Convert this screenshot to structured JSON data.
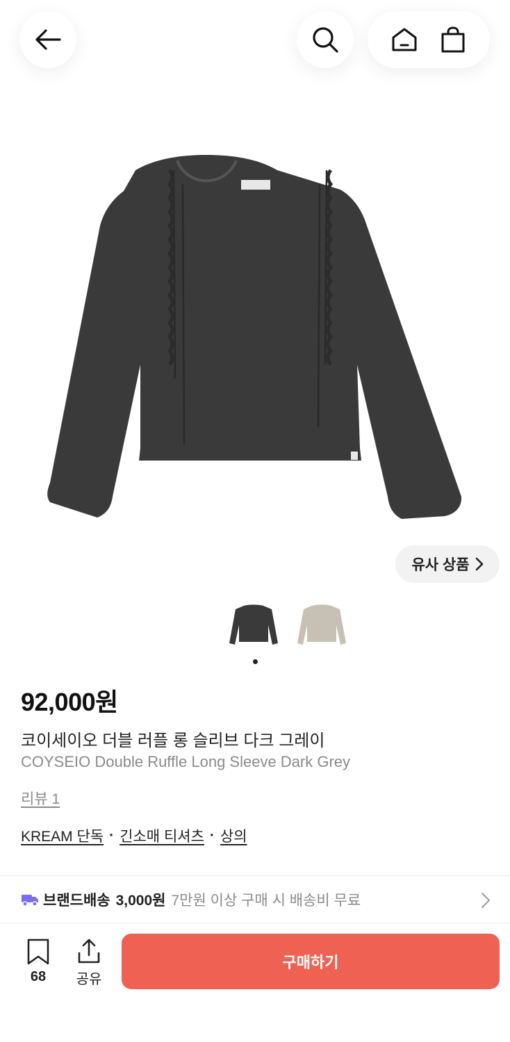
{
  "header": {
    "back_icon": "arrow-left-icon",
    "search_icon": "search-icon",
    "home_icon": "home-icon",
    "cart_icon": "shopping-bag-icon"
  },
  "gallery": {
    "similar_label": "유사 상품",
    "selected_thumb": 0,
    "colors": [
      "#3a3a3a",
      "#c6c1b4"
    ]
  },
  "product": {
    "price": "92,000원",
    "name_ko": "코이세이오 더블 러플 롱 슬리브 다크 그레이",
    "name_en": "COYSEIO Double Ruffle Long Sleeve Dark Grey",
    "review": "리뷰 1",
    "categories": [
      "KREAM 단독",
      "긴소매 티셔츠",
      "상의"
    ]
  },
  "shipping": {
    "label": "브랜드배송",
    "fee": "3,000원",
    "note": "7만원 이상 구매 시 배송비 무료",
    "icon_color": "#7b6cf0"
  },
  "bottom": {
    "bookmark_count": "68",
    "share_label": "공유",
    "buy_label": "구매하기",
    "buy_color": "#ef6253"
  }
}
